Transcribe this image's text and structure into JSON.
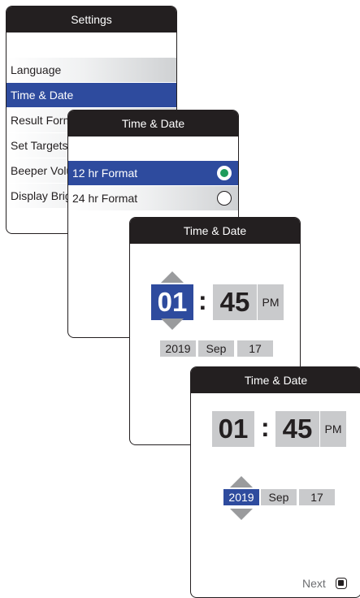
{
  "settings_screen": {
    "title": "Settings",
    "items": [
      {
        "label": "Language"
      },
      {
        "label": "Time & Date"
      },
      {
        "label": "Result Format"
      },
      {
        "label": "Set Targets"
      },
      {
        "label": "Beeper Volume"
      },
      {
        "label": "Display Brightness"
      }
    ]
  },
  "format_screen": {
    "title": "Time & Date",
    "options": [
      {
        "label": "12 hr Format",
        "selected": true
      },
      {
        "label": "24 hr Format",
        "selected": false
      }
    ]
  },
  "time_screen": {
    "title": "Time & Date",
    "hour": "01",
    "separator": ":",
    "minute": "45",
    "ampm": "PM",
    "year": "2019",
    "month": "Sep",
    "day": "17"
  },
  "date_screen": {
    "title": "Time & Date",
    "hour": "01",
    "separator": ":",
    "minute": "45",
    "ampm": "PM",
    "year": "2019",
    "month": "Sep",
    "day": "17",
    "next_label": "Next"
  },
  "colors": {
    "title_bar": "#231f20",
    "selection": "#2e4b9e",
    "field": "#c9cacc",
    "arrow": "#9a9b9d",
    "radio_on": "#1e9b5b"
  },
  "icons": [
    "radio-selected-icon",
    "radio-empty-icon",
    "up-arrow-icon",
    "down-arrow-icon",
    "next-button-icon"
  ]
}
